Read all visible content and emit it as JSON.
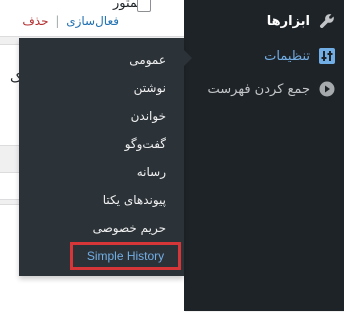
{
  "plugin_row": {
    "title": "المتور",
    "actions": {
      "activate": "فعال‌سازی",
      "separator": "|",
      "delete": "حذف"
    }
  },
  "background": {
    "stray_text": "ک"
  },
  "sidebar": {
    "tools": {
      "label": "ابزارها",
      "icon": "wrench-icon"
    },
    "settings": {
      "label": "تنظیمات",
      "icon": "settings-sliders-icon"
    },
    "collapse": {
      "label": "جمع کردن فهرست",
      "icon": "collapse-arrow-icon"
    }
  },
  "submenu": {
    "general": "عمومی",
    "writing": "نوشتن",
    "reading": "خواندن",
    "discussion": "گفت‌وگو",
    "media": "رسانه",
    "permalinks": "پیوندهای یکتا",
    "privacy": "حریم خصوصی",
    "simple_history": "Simple History"
  },
  "colors": {
    "sidebar_bg": "#1d2327",
    "flyout_bg": "#2c3338",
    "accent_blue": "#72aee6",
    "highlight_red": "#d63638",
    "delete_red": "#b32d2e"
  }
}
